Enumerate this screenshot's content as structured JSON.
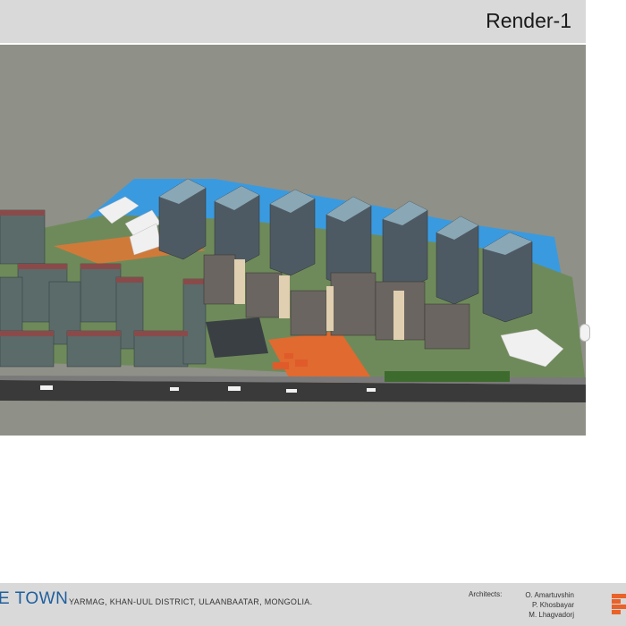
{
  "header": {
    "title": "Render-1"
  },
  "render": {
    "image_alt": "Aerial 3D render of residential high-rise complex"
  },
  "footer": {
    "project_name": "E TOWN",
    "location": "YARMAG, KHAN-UUL DISTRICT, ULAANBAATAR, MONGOLIA.",
    "architects_label": "Architects:",
    "architects": [
      "O. Amartuvshin",
      "P. Khosbayar",
      "M. Lhagvadorj"
    ]
  },
  "colors": {
    "header_bg": "#d9d9d9",
    "footer_bg": "#d9d9d9",
    "render_bg": "#8f9088",
    "brand_blue": "#1f5f9e",
    "logo_orange": "#e8622a"
  }
}
